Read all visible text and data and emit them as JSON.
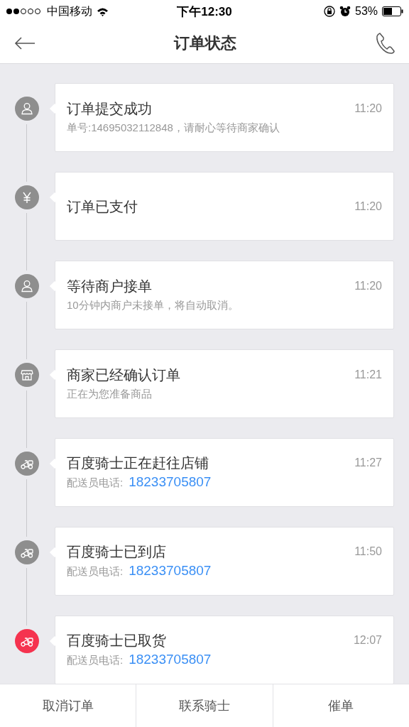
{
  "status_bar": {
    "carrier": "中国移动",
    "time": "下午12:30",
    "battery": "53%"
  },
  "nav_bar": {
    "title": "订单状态"
  },
  "steps": [
    {
      "kind": "customer",
      "active": false,
      "title": "订单提交成功",
      "time": "11:20",
      "detail": "单号:14695032112848，请耐心等待商家确认"
    },
    {
      "kind": "payment",
      "active": false,
      "title": "订单已支付",
      "time": "11:20"
    },
    {
      "kind": "customer",
      "active": false,
      "title": "等待商户接单",
      "time": "11:20",
      "detail": "10分钟内商户未接单，将自动取消。"
    },
    {
      "kind": "store",
      "active": false,
      "title": "商家已经确认订单",
      "time": "11:21",
      "detail": "正在为您准备商品"
    },
    {
      "kind": "rider",
      "active": false,
      "title": "百度骑士正在赶往店铺",
      "time": "11:27",
      "phone_label": "配送员电话:",
      "phone": "18233705807"
    },
    {
      "kind": "rider",
      "active": false,
      "title": "百度骑士已到店",
      "time": "11:50",
      "phone_label": "配送员电话:",
      "phone": "18233705807"
    },
    {
      "kind": "rider",
      "active": true,
      "title": "百度骑士已取货",
      "time": "12:07",
      "phone_label": "配送员电话:",
      "phone": "18233705807"
    }
  ],
  "actions": [
    "取消订单",
    "联系骑士",
    "催单"
  ]
}
